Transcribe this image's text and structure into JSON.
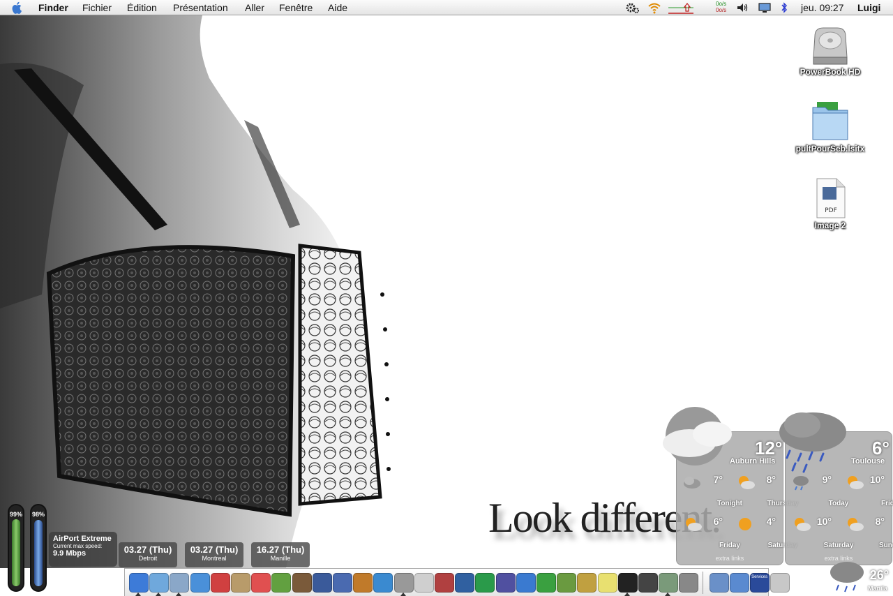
{
  "menubar": {
    "app": "Finder",
    "menus": [
      "Fichier",
      "Édition",
      "Présentation",
      "Aller",
      "Fenêtre",
      "Aide"
    ],
    "net_up": "0o/s",
    "net_down": "0o/s",
    "clock": "jeu. 09:27",
    "user": "Luigi"
  },
  "desktop": {
    "icons": [
      {
        "label": "PowerBook HD",
        "icon": "hard-drive-icon"
      },
      {
        "label": "pultPourSeb.lsitx",
        "icon": "archive-folder-icon"
      },
      {
        "label": "Image 2",
        "icon": "pdf-document-icon",
        "badge": "PDF"
      }
    ]
  },
  "wallpaper": {
    "slogan": "Look different."
  },
  "battery": [
    {
      "percent": "99%",
      "level": 0.99,
      "color": "#5a9a3a"
    },
    {
      "percent": "98%",
      "level": 0.98,
      "color": "#3a6aa8"
    }
  ],
  "airport": {
    "title": "AirPort Extreme",
    "subtitle": "Current max speed:",
    "speed": "9.9 Mbps"
  },
  "clocks": [
    {
      "time": "03.27 (Thu)",
      "city": "Detroit"
    },
    {
      "time": "03.27 (Thu)",
      "city": "Montreal"
    },
    {
      "time": "16.27 (Thu)",
      "city": "Manille"
    }
  ],
  "weather": [
    {
      "city": "Auburn Hills",
      "temp": "12°",
      "extra": "extra links",
      "forecast": [
        {
          "day": "Tonight",
          "temp": "7°",
          "icon": "cloudy-night-icon"
        },
        {
          "day": "Thursday",
          "temp": "8°",
          "icon": "partly-sunny-icon"
        },
        {
          "day": "Friday",
          "temp": "6°",
          "icon": "partly-sunny-icon"
        },
        {
          "day": "Saturday",
          "temp": "4°",
          "icon": "sunny-icon"
        }
      ]
    },
    {
      "city": "Toulouse",
      "temp": "6°",
      "extra": "extra links",
      "forecast": [
        {
          "day": "Today",
          "temp": "9°",
          "icon": "rain-icon"
        },
        {
          "day": "Friday",
          "temp": "10°",
          "icon": "partly-sunny-icon"
        },
        {
          "day": "Saturday",
          "temp": "10°",
          "icon": "partly-sunny-icon"
        },
        {
          "day": "Sunday",
          "temp": "8°",
          "icon": "partly-sunny-icon"
        }
      ]
    }
  ],
  "manila": {
    "temp": "26°",
    "city": "Manila"
  },
  "dock": {
    "apps": [
      {
        "name": "finder-icon",
        "color": "#3d7bd8",
        "running": true
      },
      {
        "name": "safari-icon",
        "color": "#6fa8dc",
        "running": true
      },
      {
        "name": "mail-icon",
        "color": "#8aa7c8",
        "running": true
      },
      {
        "name": "ichat-icon",
        "color": "#4a90d9",
        "running": false
      },
      {
        "name": "adium-icon",
        "color": "#d04040",
        "running": false
      },
      {
        "name": "address-book-icon",
        "color": "#b89b6a",
        "running": false
      },
      {
        "name": "ical-icon",
        "color": "#e05050",
        "running": false
      },
      {
        "name": "itunes-icon",
        "color": "#62a040",
        "running": false
      },
      {
        "name": "iphoto-icon",
        "color": "#7a5a3a",
        "running": false
      },
      {
        "name": "imovie-icon",
        "color": "#3a5a9a",
        "running": false
      },
      {
        "name": "idvd-icon",
        "color": "#4a6ab0",
        "running": false
      },
      {
        "name": "garageband-icon",
        "color": "#c07a2a",
        "running": false
      },
      {
        "name": "quicktime-icon",
        "color": "#3a8ad0",
        "running": false
      },
      {
        "name": "system-prefs-icon",
        "color": "#999999",
        "running": true
      },
      {
        "name": "textedit-icon",
        "color": "#cfcfcf",
        "running": false
      },
      {
        "name": "preview-icon",
        "color": "#b04040",
        "running": false
      },
      {
        "name": "photoshop-icon",
        "color": "#3060a0",
        "running": false
      },
      {
        "name": "dreamweaver-icon",
        "color": "#2a9a4a",
        "running": false
      },
      {
        "name": "bbedit-icon",
        "color": "#5050a0",
        "running": false
      },
      {
        "name": "word-icon",
        "color": "#3a7ad0",
        "running": false
      },
      {
        "name": "excel-icon",
        "color": "#3aa040",
        "running": false
      },
      {
        "name": "network-icon",
        "color": "#6a9a40",
        "running": false
      },
      {
        "name": "stuffit-icon",
        "color": "#c0a040",
        "running": false
      },
      {
        "name": "stickies-icon",
        "color": "#e8e070",
        "running": false
      },
      {
        "name": "terminal-icon",
        "color": "#222222",
        "running": true
      },
      {
        "name": "detective-icon",
        "color": "#444444",
        "running": false
      },
      {
        "name": "utility-icon",
        "color": "#7a9a7a",
        "running": true
      },
      {
        "name": "disk-utility-icon",
        "color": "#888888",
        "running": false
      }
    ],
    "docs": [
      {
        "name": "url-icon",
        "color": "#6a90c8"
      },
      {
        "name": "mail-doc-icon",
        "color": "#5a8ad0"
      },
      {
        "name": "services-icon",
        "color": "#2a4a9a",
        "label": "Services"
      },
      {
        "name": "trash-icon",
        "color": "#c8c8c8"
      }
    ]
  }
}
